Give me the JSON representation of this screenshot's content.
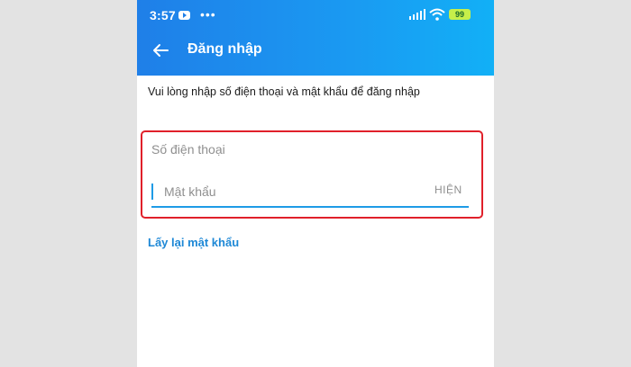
{
  "status_bar": {
    "time": "3:57",
    "dots": "•••",
    "battery": "99"
  },
  "header": {
    "title": "Đăng nhập"
  },
  "instruction": "Vui lòng nhập số điện thoại và mật khẩu để đăng nhập",
  "form": {
    "phone_placeholder": "Số điện thoại",
    "password_placeholder": "Mật khẩu",
    "show_label": "HIỆN"
  },
  "forgot_password": "Lấy lại mật khẩu",
  "colors": {
    "appbar_start": "#1f7fe8",
    "appbar_end": "#12b0f6",
    "accent": "#1e9be6",
    "highlight_border": "#e0202a"
  },
  "icons": {
    "back": "arrow-left",
    "youtube": "youtube-notification",
    "signal": "signal-bars",
    "wifi": "wifi",
    "battery": "battery"
  }
}
